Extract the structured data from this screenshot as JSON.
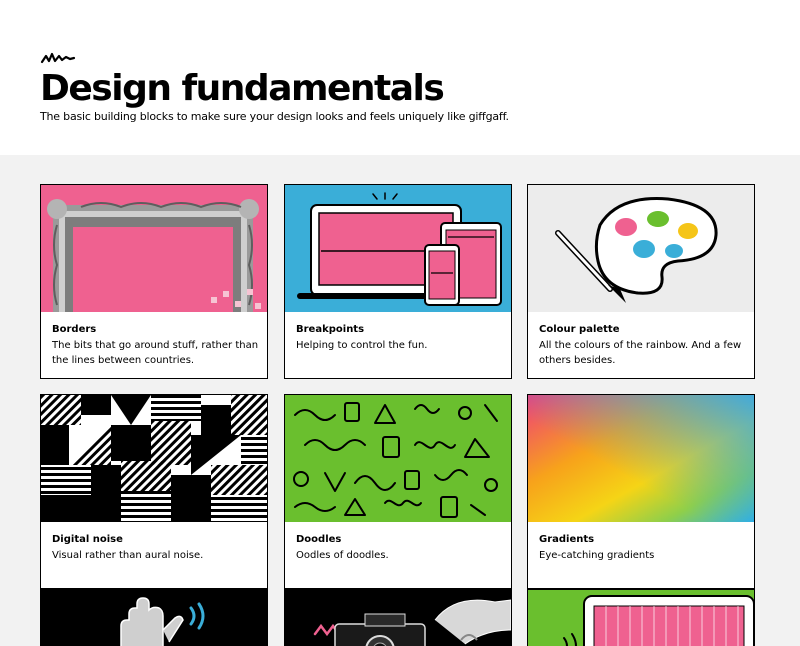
{
  "page": {
    "title": "Design fundamentals",
    "subtitle": "The basic building blocks to make sure your design looks and feels uniquely like giffgaff."
  },
  "cards": [
    {
      "title": "Borders",
      "description": "The bits that go around stuff, rather than the lines between countries.",
      "image_icon": "ornate-frame-icon"
    },
    {
      "title": "Breakpoints",
      "description": "Helping to control the fun.",
      "image_icon": "devices-icon"
    },
    {
      "title": "Colour palette",
      "description": "All the colours of the rainbow. And a few others besides.",
      "image_icon": "palette-icon"
    },
    {
      "title": "Digital noise",
      "description": "Visual rather than aural noise.",
      "image_icon": "noise-pattern-icon"
    },
    {
      "title": "Doodles",
      "description": "Oodles of doodles.",
      "image_icon": "doodle-pattern-icon"
    },
    {
      "title": "Gradients",
      "description": "Eye-catching gradients",
      "image_icon": "gradient-icon"
    },
    {
      "image_icon": "hand-icon"
    },
    {
      "image_icon": "camera-icon"
    },
    {
      "image_icon": "tablet-icon"
    }
  ],
  "colors": {
    "pink": "#ef6190",
    "blue": "#3aaed8",
    "green": "#6abf2e",
    "light_grey": "#f2f2f2"
  }
}
